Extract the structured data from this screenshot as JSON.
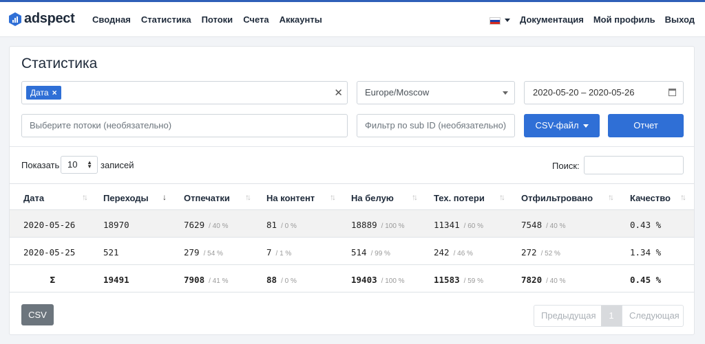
{
  "brand": {
    "name": "adspect"
  },
  "nav": {
    "left": [
      "Сводная",
      "Статистика",
      "Потоки",
      "Счета",
      "Аккаунты"
    ],
    "right": [
      "Документация",
      "Мой профиль",
      "Выход"
    ]
  },
  "page": {
    "title": "Статистика"
  },
  "filters": {
    "group_tag": "Дата",
    "timezone": "Europe/Moscow",
    "date_range": "2020-05-20 – 2020-05-26",
    "flows_placeholder": "Выберите потоки (необязательно)",
    "subid_placeholder": "Фильтр по sub ID (необязательно)",
    "csv_file_label": "CSV-файл",
    "report_label": "Отчет"
  },
  "table_controls": {
    "show_label": "Показать",
    "page_size": "10",
    "records_label": "записей",
    "search_label": "Поиск:"
  },
  "table": {
    "headers": [
      "Дата",
      "Переходы",
      "Отпечатки",
      "На контент",
      "На белую",
      "Тех. потери",
      "Отфильтровано",
      "Качество"
    ],
    "rows": [
      {
        "date": "2020-05-26",
        "clicks": "18970",
        "prints": "7629",
        "prints_pct": "/ 40 %",
        "content": "81",
        "content_pct": "/ 0 %",
        "white": "18889",
        "white_pct": "/ 100 %",
        "loss": "11341",
        "loss_pct": "/ 60 %",
        "filtered": "7548",
        "filtered_pct": "/ 40 %",
        "quality": "0.43 %"
      },
      {
        "date": "2020-05-25",
        "clicks": "521",
        "prints": "279",
        "prints_pct": "/ 54 %",
        "content": "7",
        "content_pct": "/ 1 %",
        "white": "514",
        "white_pct": "/ 99 %",
        "loss": "242",
        "loss_pct": "/ 46 %",
        "filtered": "272",
        "filtered_pct": "/ 52 %",
        "quality": "1.34 %"
      }
    ],
    "total": {
      "date": "Σ",
      "clicks": "19491",
      "prints": "7908",
      "prints_pct": "/ 41 %",
      "content": "88",
      "content_pct": "/ 0 %",
      "white": "19403",
      "white_pct": "/ 100 %",
      "loss": "11583",
      "loss_pct": "/ 59 %",
      "filtered": "7820",
      "filtered_pct": "/ 40 %",
      "quality": "0.45 %"
    }
  },
  "footer": {
    "csv_label": "CSV",
    "prev_label": "Предыдущая",
    "current_page": "1",
    "next_label": "Следующая"
  },
  "colors": {
    "accent": "#2f6fd6",
    "topline": "#2f5fb8",
    "secondary": "#6c757d"
  },
  "icons": {
    "language": "russia-flag-icon",
    "calendar": "calendar-icon",
    "sort": "sort-icon",
    "clear": "close-icon"
  }
}
